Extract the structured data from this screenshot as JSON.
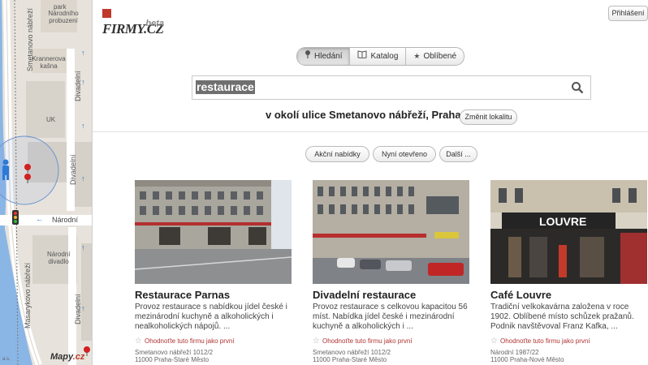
{
  "map": {
    "labels": {
      "park": "park",
      "narodni_probuzeni": "Národního probuzení",
      "krannerova_kasna": "Krannerova kašna",
      "smetanovo_vertical": "Smetanovo nábřeží",
      "divadelni_top": "Divadelní",
      "uk": "UK",
      "divadelni_mid": "Divadelní",
      "narodni": "Národní",
      "narodni_divadlo": "Národní divadlo",
      "masarykovo": "Masarykovo nábřeží",
      "divadelni_bottom": "Divadelní"
    },
    "logo_main": "Mapy",
    "logo_tld": ".cz",
    "scale": "a.s."
  },
  "header": {
    "logo_text": "FIRMY.CZ",
    "logo_beta": "beta",
    "login_label": "Přihlášení"
  },
  "tabs": [
    {
      "label": "Hledání",
      "icon": "pin-icon",
      "active": true
    },
    {
      "label": "Katalog",
      "icon": "book-icon",
      "active": false
    },
    {
      "label": "Oblíbené",
      "icon": "star-icon",
      "active": false
    }
  ],
  "search": {
    "value": "restaurace"
  },
  "location": {
    "text": "v okolí ulice Smetanovo nábřeží, Praha",
    "change_label": "Změnit lokalitu"
  },
  "filters": [
    "Akční nabídky",
    "Nyní otevřeno",
    "Další ..."
  ],
  "results": [
    {
      "name": "Restaurace Parnas",
      "description": "Provoz restaurace s nabídkou jídel české i mezinárodní kuchyně a alkoholických i nealkoholických nápojů. ...",
      "rate_label": "Ohodnoťte tuto firmu jako první",
      "street": "Smetanovo nábřeží 1012/2",
      "city": "11000 Praha-Staré Město"
    },
    {
      "name": "Divadelní restaurace",
      "description": "Provoz restaurace s celkovou kapacitou 56 míst. Nabídka jídel české i mezinárodní kuchyně a alkoholických i ...",
      "rate_label": "Ohodnoťte tuto firmu jako první",
      "street": "Smetanovo nábřeží 1012/2",
      "city": "11000 Praha-Staré Město"
    },
    {
      "name": "Café Louvre",
      "description": "Tradiční velkokavárna založena v roce 1902. Oblíbené místo schůzek pražanů. Podnik navštěvoval Franz Kafka, ...",
      "rate_label": "Ohodnoťte tuto firmu jako první",
      "street": "Národní 1987/22",
      "city": "11000 Praha-Nové Město"
    }
  ],
  "photo_signs": {
    "louvre": "LOUVRE"
  },
  "colors": {
    "accent_red": "#c0392b",
    "rate_red": "#b03434",
    "river": "#8ab6e6",
    "map_bg": "#e7e3dc"
  }
}
